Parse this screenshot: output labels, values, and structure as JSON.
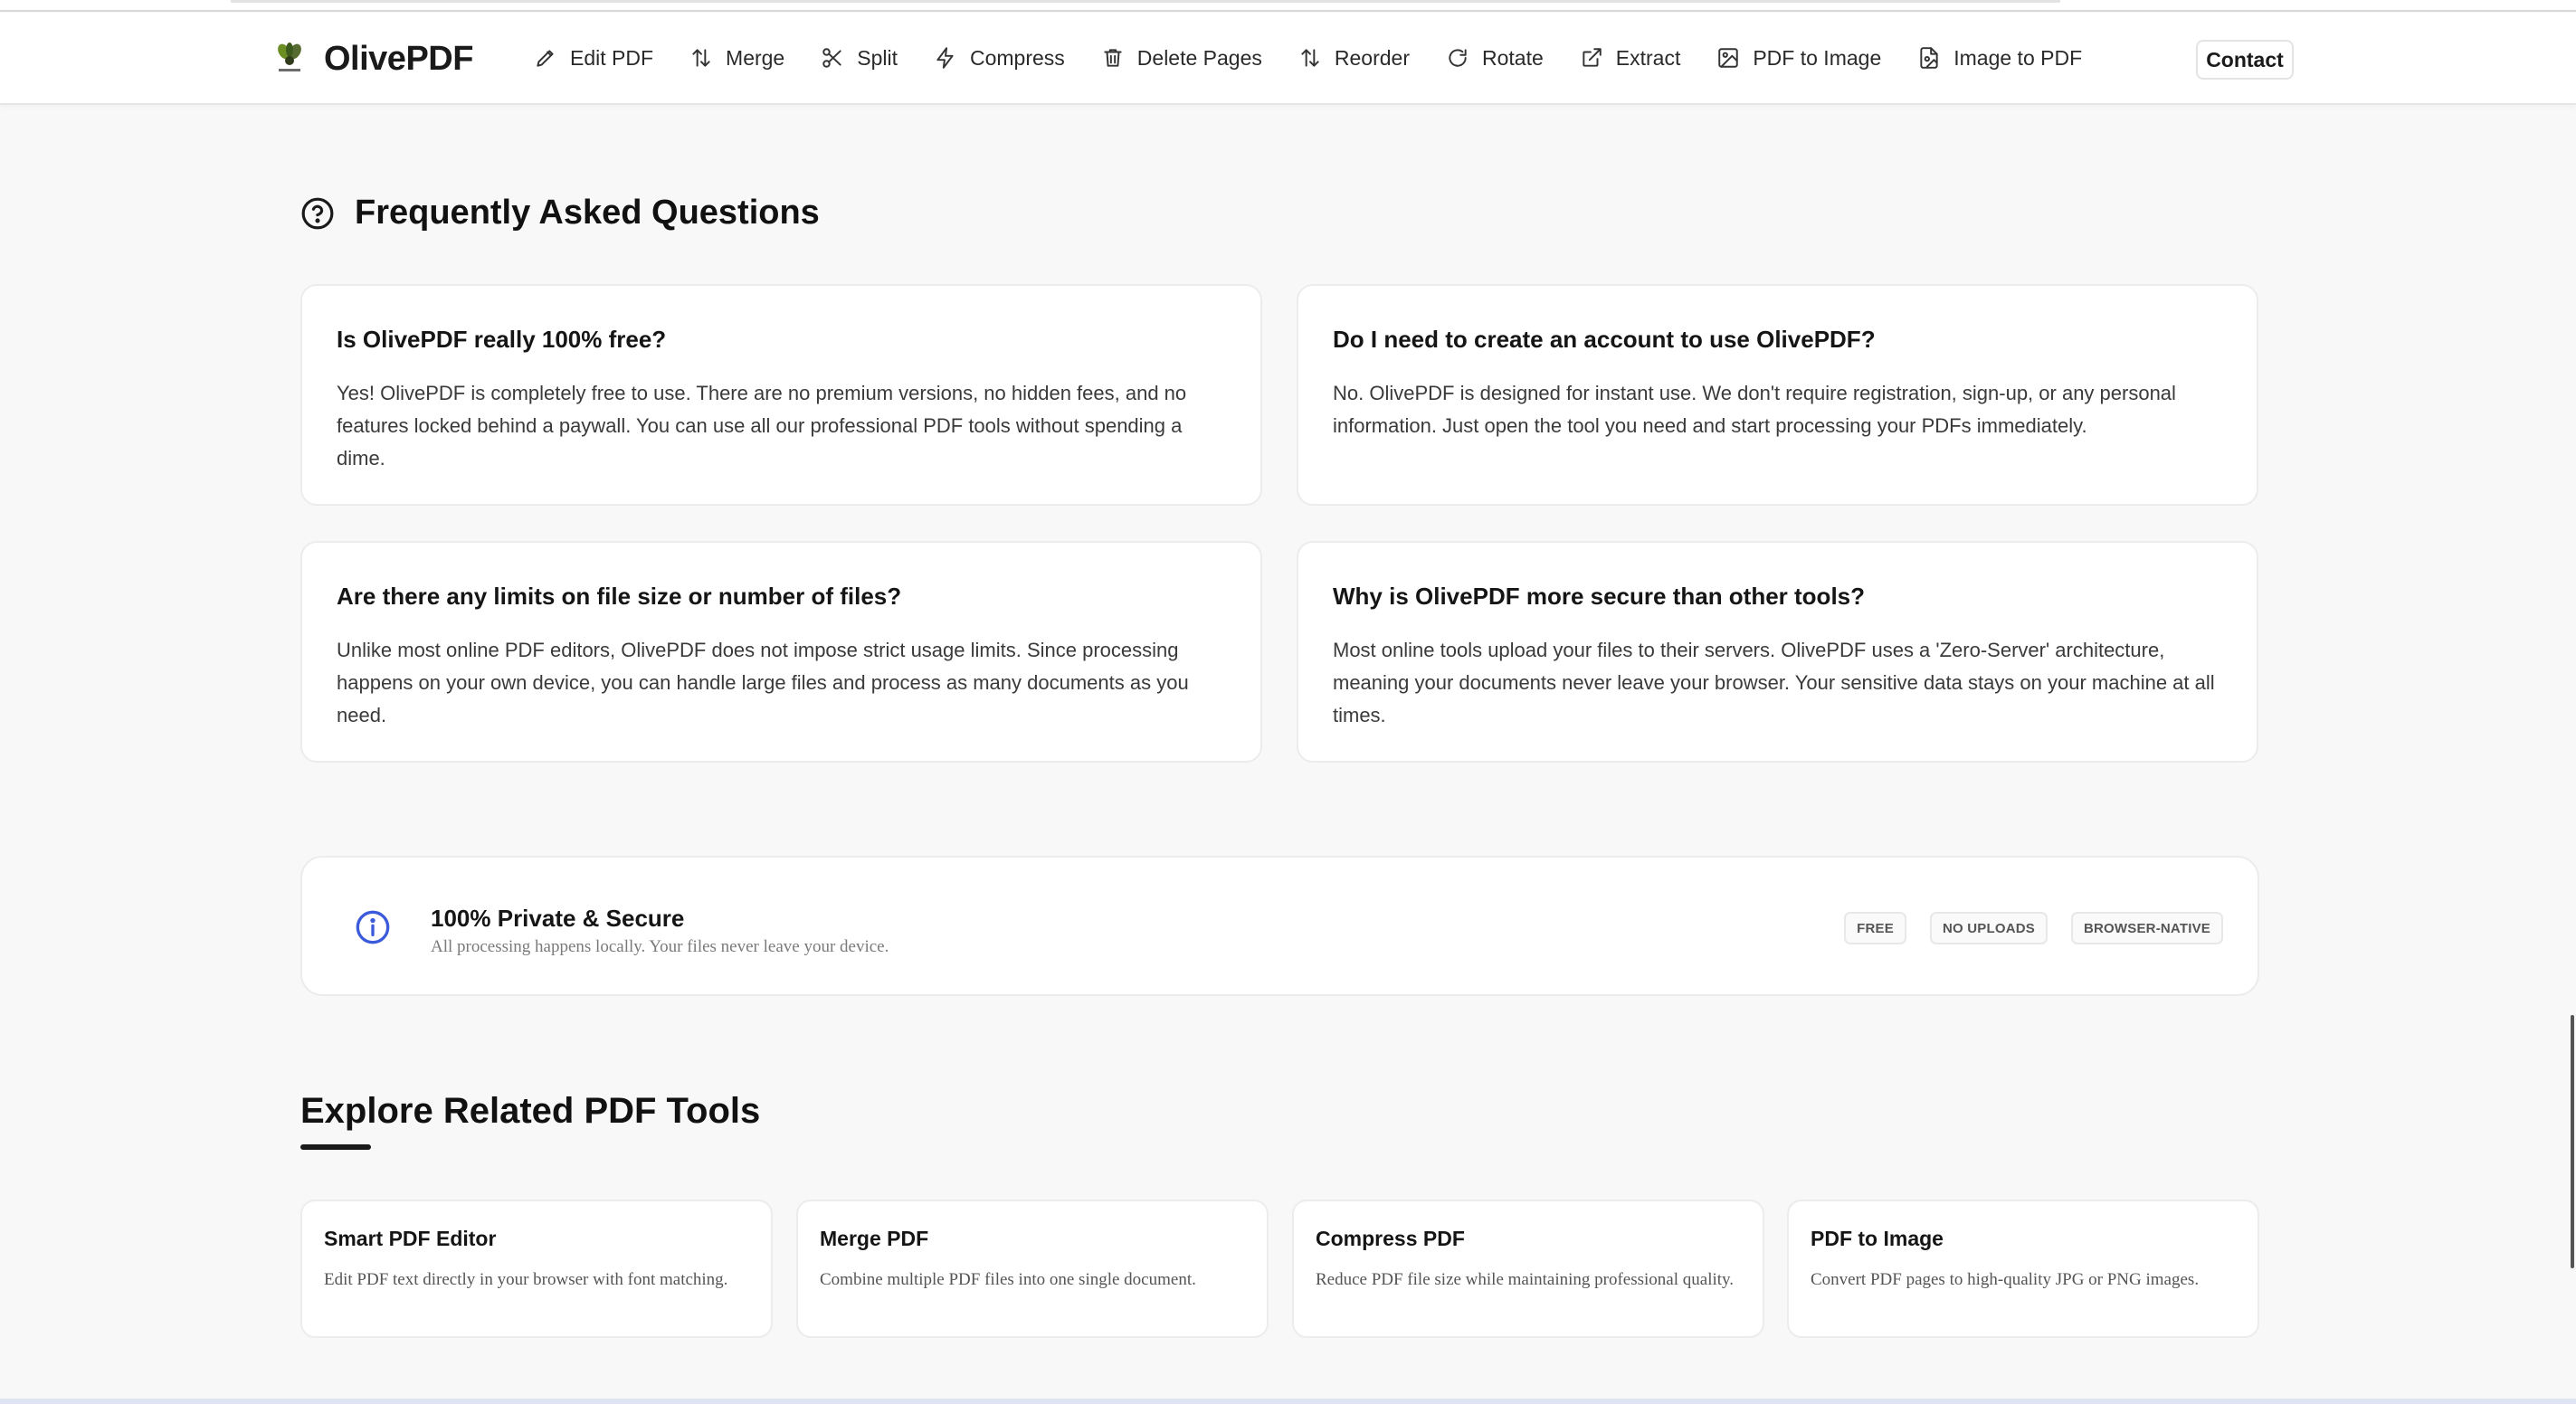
{
  "brand": {
    "name": "OlivePDF"
  },
  "nav": {
    "items": [
      {
        "label": "Edit PDF",
        "icon": "pencil-icon"
      },
      {
        "label": "Merge",
        "icon": "arrows-updown-icon"
      },
      {
        "label": "Split",
        "icon": "scissors-icon"
      },
      {
        "label": "Compress",
        "icon": "bolt-icon"
      },
      {
        "label": "Delete Pages",
        "icon": "trash-icon"
      },
      {
        "label": "Reorder",
        "icon": "arrows-updown-icon"
      },
      {
        "label": "Rotate",
        "icon": "rotate-icon"
      },
      {
        "label": "Extract",
        "icon": "external-link-icon"
      },
      {
        "label": "PDF to Image",
        "icon": "image-icon"
      },
      {
        "label": "Image to PDF",
        "icon": "file-image-icon"
      }
    ],
    "contact_label": "Contact"
  },
  "faq": {
    "title": "Frequently Asked Questions",
    "items": [
      {
        "question": "Is OlivePDF really 100% free?",
        "answer": "Yes! OlivePDF is completely free to use. There are no premium versions, no hidden fees, and no features locked behind a paywall. You can use all our professional PDF tools without spending a dime."
      },
      {
        "question": "Do I need to create an account to use OlivePDF?",
        "answer": "No. OlivePDF is designed for instant use. We don't require registration, sign-up, or any personal information. Just open the tool you need and start processing your PDFs immediately."
      },
      {
        "question": "Are there any limits on file size or number of files?",
        "answer": "Unlike most online PDF editors, OlivePDF does not impose strict usage limits. Since processing happens on your own device, you can handle large files and process as many documents as you need."
      },
      {
        "question": "Why is OlivePDF more secure than other tools?",
        "answer": "Most online tools upload your files to their servers. OlivePDF uses a 'Zero-Server' architecture, meaning your documents never leave your browser. Your sensitive data stays on your machine at all times."
      }
    ]
  },
  "privacy": {
    "title": "100% Private & Secure",
    "subtitle": "All processing happens locally. Your files never leave your device.",
    "badges": [
      "FREE",
      "NO UPLOADS",
      "BROWSER-NATIVE"
    ],
    "accent_color": "#3b5bdb"
  },
  "related": {
    "title": "Explore Related PDF Tools",
    "tools": [
      {
        "name": "Smart PDF Editor",
        "description": "Edit PDF text directly in your browser with font matching."
      },
      {
        "name": "Merge PDF",
        "description": "Combine multiple PDF files into one single document."
      },
      {
        "name": "Compress PDF",
        "description": "Reduce PDF file size while maintaining professional quality."
      },
      {
        "name": "PDF to Image",
        "description": "Convert PDF pages to high-quality JPG or PNG images."
      }
    ]
  }
}
